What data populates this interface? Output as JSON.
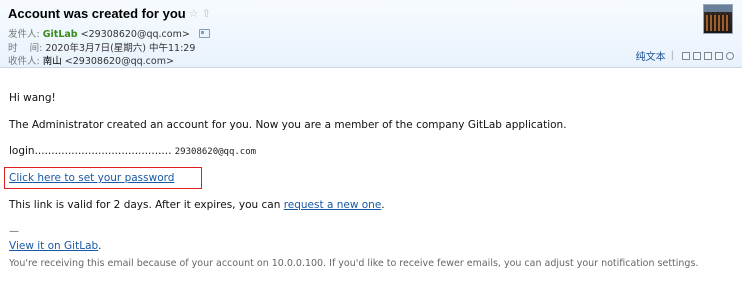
{
  "header": {
    "subject": "Account was created for you",
    "star_icon": "star-icon",
    "flag_icon": "flag-icon",
    "from_label": "发件人:",
    "from_name": "GitLab",
    "from_address": "<29308620@qq.com>",
    "time_label": "时    间:",
    "time_value": "2020年3月7日(星期六) 中午11:29",
    "to_label": "收件人:",
    "to_name": "南山",
    "to_address": "<29308620@qq.com>",
    "plain_text_label": "纯文本"
  },
  "body": {
    "greeting": "Hi wang!",
    "intro": "The Administrator created an account for you. Now you are a member of the company GitLab application.",
    "login_label": "login.........................................",
    "login_value": "29308620@qq.com",
    "set_password_link": "Click here to set your password",
    "validity_prefix": "This link is valid for 2 days. After it expires, you can ",
    "request_link": "request a new one",
    "validity_suffix": ".",
    "separator": "—",
    "view_link": "View it on GitLab",
    "view_suffix": ".",
    "footer_text": "You're receiving this email because of your account on 10.0.0.100. If you'd like to receive fewer emails, you can adjust your notification settings."
  }
}
